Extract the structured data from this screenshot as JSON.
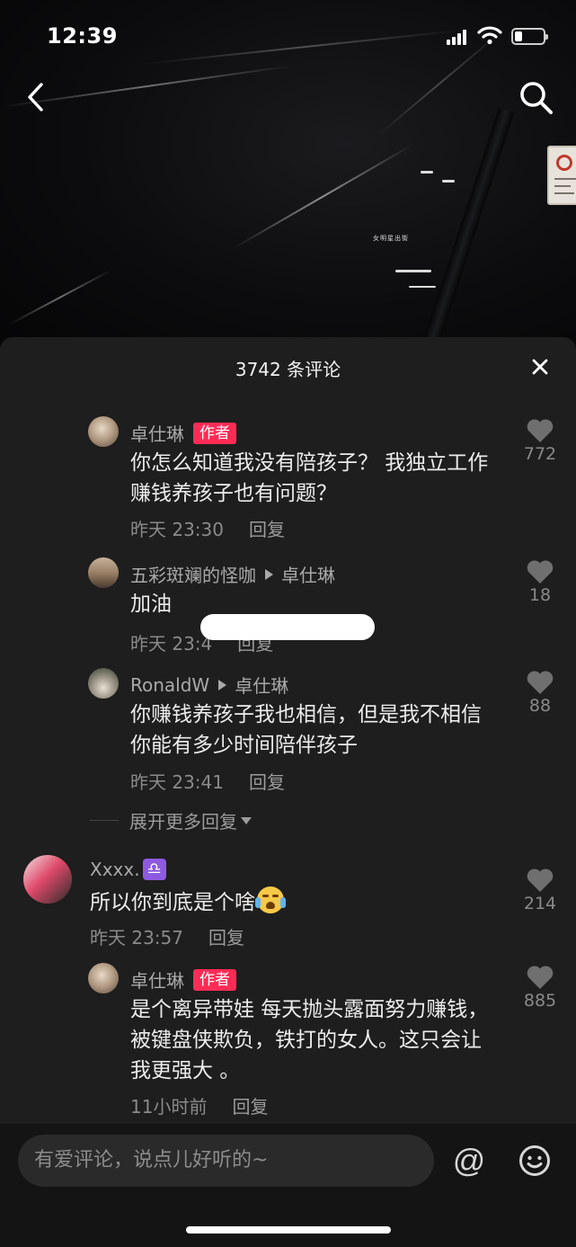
{
  "status_bar": {
    "time": "12:39"
  },
  "video": {
    "caption": "女明星出街"
  },
  "sheet": {
    "title": "3742 条评论"
  },
  "comments": [
    {
      "author": "卓仕琳",
      "tag": "作者",
      "text": "你怎么知道我没有陪孩子？ 我独立工作赚钱养孩子也有问题？",
      "time": "昨天 23:30",
      "reply_label": "回复",
      "likes": "772"
    },
    {
      "author": "五彩斑斓的怪咖",
      "reply_to": "卓仕琳",
      "text": "加油",
      "time": "昨天 23:4",
      "reply_label": "回复",
      "likes": "18"
    },
    {
      "author": "RonaldW",
      "reply_to": "卓仕琳",
      "text": "你赚钱养孩子我也相信，但是我不相信你能有多少时间陪伴孩子",
      "time": "昨天 23:41",
      "reply_label": "回复",
      "likes": "88"
    },
    {
      "author": "Xxxx.",
      "author_badge": "♎",
      "text": "所以你到底是个啥",
      "time": "昨天 23:57",
      "reply_label": "回复",
      "likes": "214"
    },
    {
      "author": "卓仕琳",
      "tag": "作者",
      "text": "是个离异带娃 每天抛头露面努力赚钱，被键盘侠欺负，铁打的女人。这只会让我更强大 。",
      "time": "11小时前",
      "reply_label": "回复",
      "likes": "885"
    }
  ],
  "expand_replies": "展开更多回复",
  "input": {
    "placeholder": "有爱评论，说点儿好听的~"
  },
  "icons": {
    "back": "chevron-left-icon",
    "search": "search-icon",
    "close": "close-icon",
    "like": "heart-icon",
    "at": "at-icon",
    "emoji": "smiley-icon"
  },
  "colors": {
    "author_tag": "#fe2c55",
    "sheet_bg": "#1e1e1e"
  }
}
